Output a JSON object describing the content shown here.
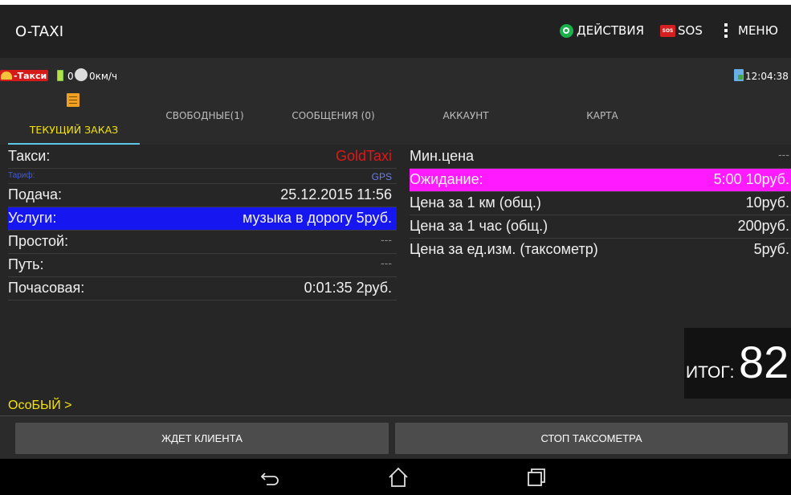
{
  "actionbar": {
    "title": "O-TAXI",
    "actions_label": "ДЕЙСТВИЯ",
    "sos_icon_text": "SOS",
    "sos_label": "SOS",
    "menu_label": "МЕНЮ"
  },
  "status": {
    "taxi_badge": "-Такси",
    "satellite_count": "0",
    "speed": "0км/ч",
    "time": "12:04:38"
  },
  "tabs": [
    {
      "label": "ТЕКУЩИЙ ЗАКАЗ",
      "active": true
    },
    {
      "label": "СВОБОДНЫЕ(1)"
    },
    {
      "label": "СООБЩЕНИЯ (0)"
    },
    {
      "label": "АККАУНТ"
    },
    {
      "label": "КАРТА"
    }
  ],
  "order": {
    "taxi": {
      "label": "Такси:",
      "value": "GoldTaxi"
    },
    "tariff": {
      "label": "Тариф:",
      "value": "GPS"
    },
    "pickup": {
      "label": "Подача:",
      "value": "25.12.2015 11:56"
    },
    "services": {
      "label": "Услуги:",
      "value": "музыка в дорогу 5руб."
    },
    "idle": {
      "label": "Простой:",
      "value": "---"
    },
    "route": {
      "label": "Путь:",
      "value": "---"
    },
    "hourly": {
      "label": "Почасовая:",
      "value": "0:01:35 2руб."
    }
  },
  "pricing": {
    "min_price": {
      "label": "Мин.цена",
      "value": "---"
    },
    "waiting": {
      "label": "Ожидание:",
      "value": "5:00 10руб."
    },
    "per_km": {
      "label": "Цена за 1 км (общ.)",
      "value": "10руб."
    },
    "per_hour": {
      "label": "Цена за 1 час (общ.)",
      "value": "200руб."
    },
    "per_unit": {
      "label": "Цена за ед.изм. (таксометр)",
      "value": "5руб."
    }
  },
  "total": {
    "label": "ИТОГ:",
    "value": "82"
  },
  "special_link": "ОсоБЫЙ  >",
  "buttons": {
    "wait_client": "ЖДЕТ КЛИЕНТА",
    "stop_meter": "СТОП ТАКСОМЕТРА"
  },
  "colors": {
    "taxi_value": "#e01818",
    "services_row": "#1616f0",
    "waiting_row": "#ff1aff",
    "active_tab_text": "#f5e400",
    "active_tab_underline": "#5ec7e8"
  }
}
